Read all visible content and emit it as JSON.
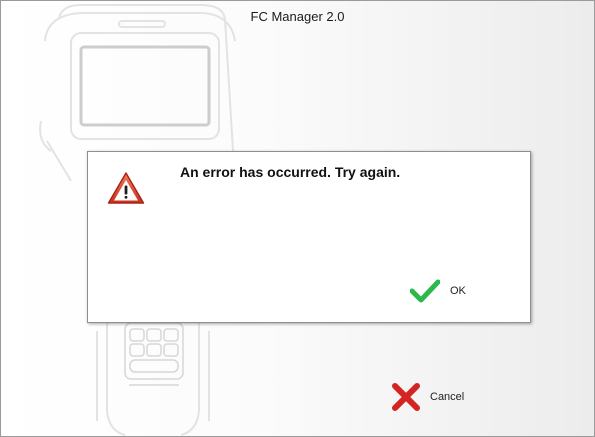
{
  "window": {
    "title": "FC Manager 2.0"
  },
  "dialog": {
    "message": "An error has occurred.  Try again.",
    "icon": "warning-icon",
    "ok_label": "OK",
    "ok_icon": "checkmark-icon"
  },
  "footer": {
    "cancel_label": "Cancel",
    "cancel_icon": "close-x-icon"
  },
  "colors": {
    "warning_red": "#d83a2a",
    "ok_green": "#2db84b",
    "cancel_red": "#d32323"
  }
}
